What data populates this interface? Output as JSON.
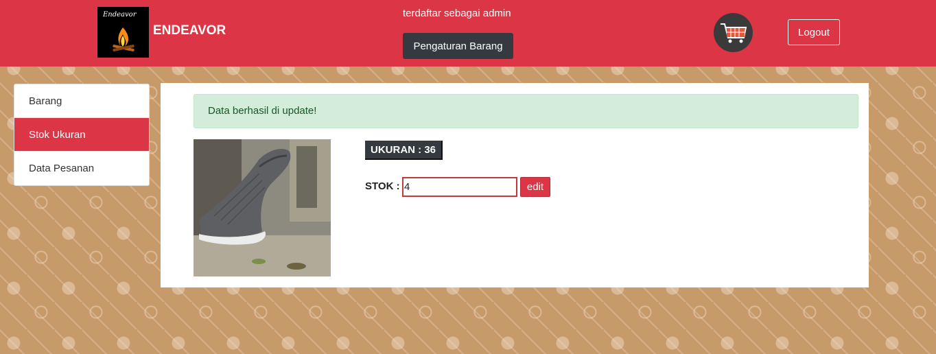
{
  "header": {
    "logo_script": "Endeavor",
    "brand": "ENDEAVOR",
    "status": "terdaftar sebagai admin",
    "settings_button": "Pengaturan Barang",
    "logout_button": "Logout",
    "cart_icon": "shopping-cart-icon"
  },
  "sidebar": {
    "items": [
      {
        "label": "Barang",
        "active": false
      },
      {
        "label": "Stok Ukuran",
        "active": true
      },
      {
        "label": "Data Pesanan",
        "active": false
      }
    ]
  },
  "main": {
    "alert": "Data berhasil di update!",
    "size_badge": "UKURAN : 36",
    "stock_label": "STOK :",
    "stock_value": "4",
    "edit_button": "edit"
  },
  "colors": {
    "primary_red": "#dc3545",
    "dark": "#343a40",
    "alert_bg": "#d4edda",
    "pattern_bg": "#c79a6a"
  }
}
